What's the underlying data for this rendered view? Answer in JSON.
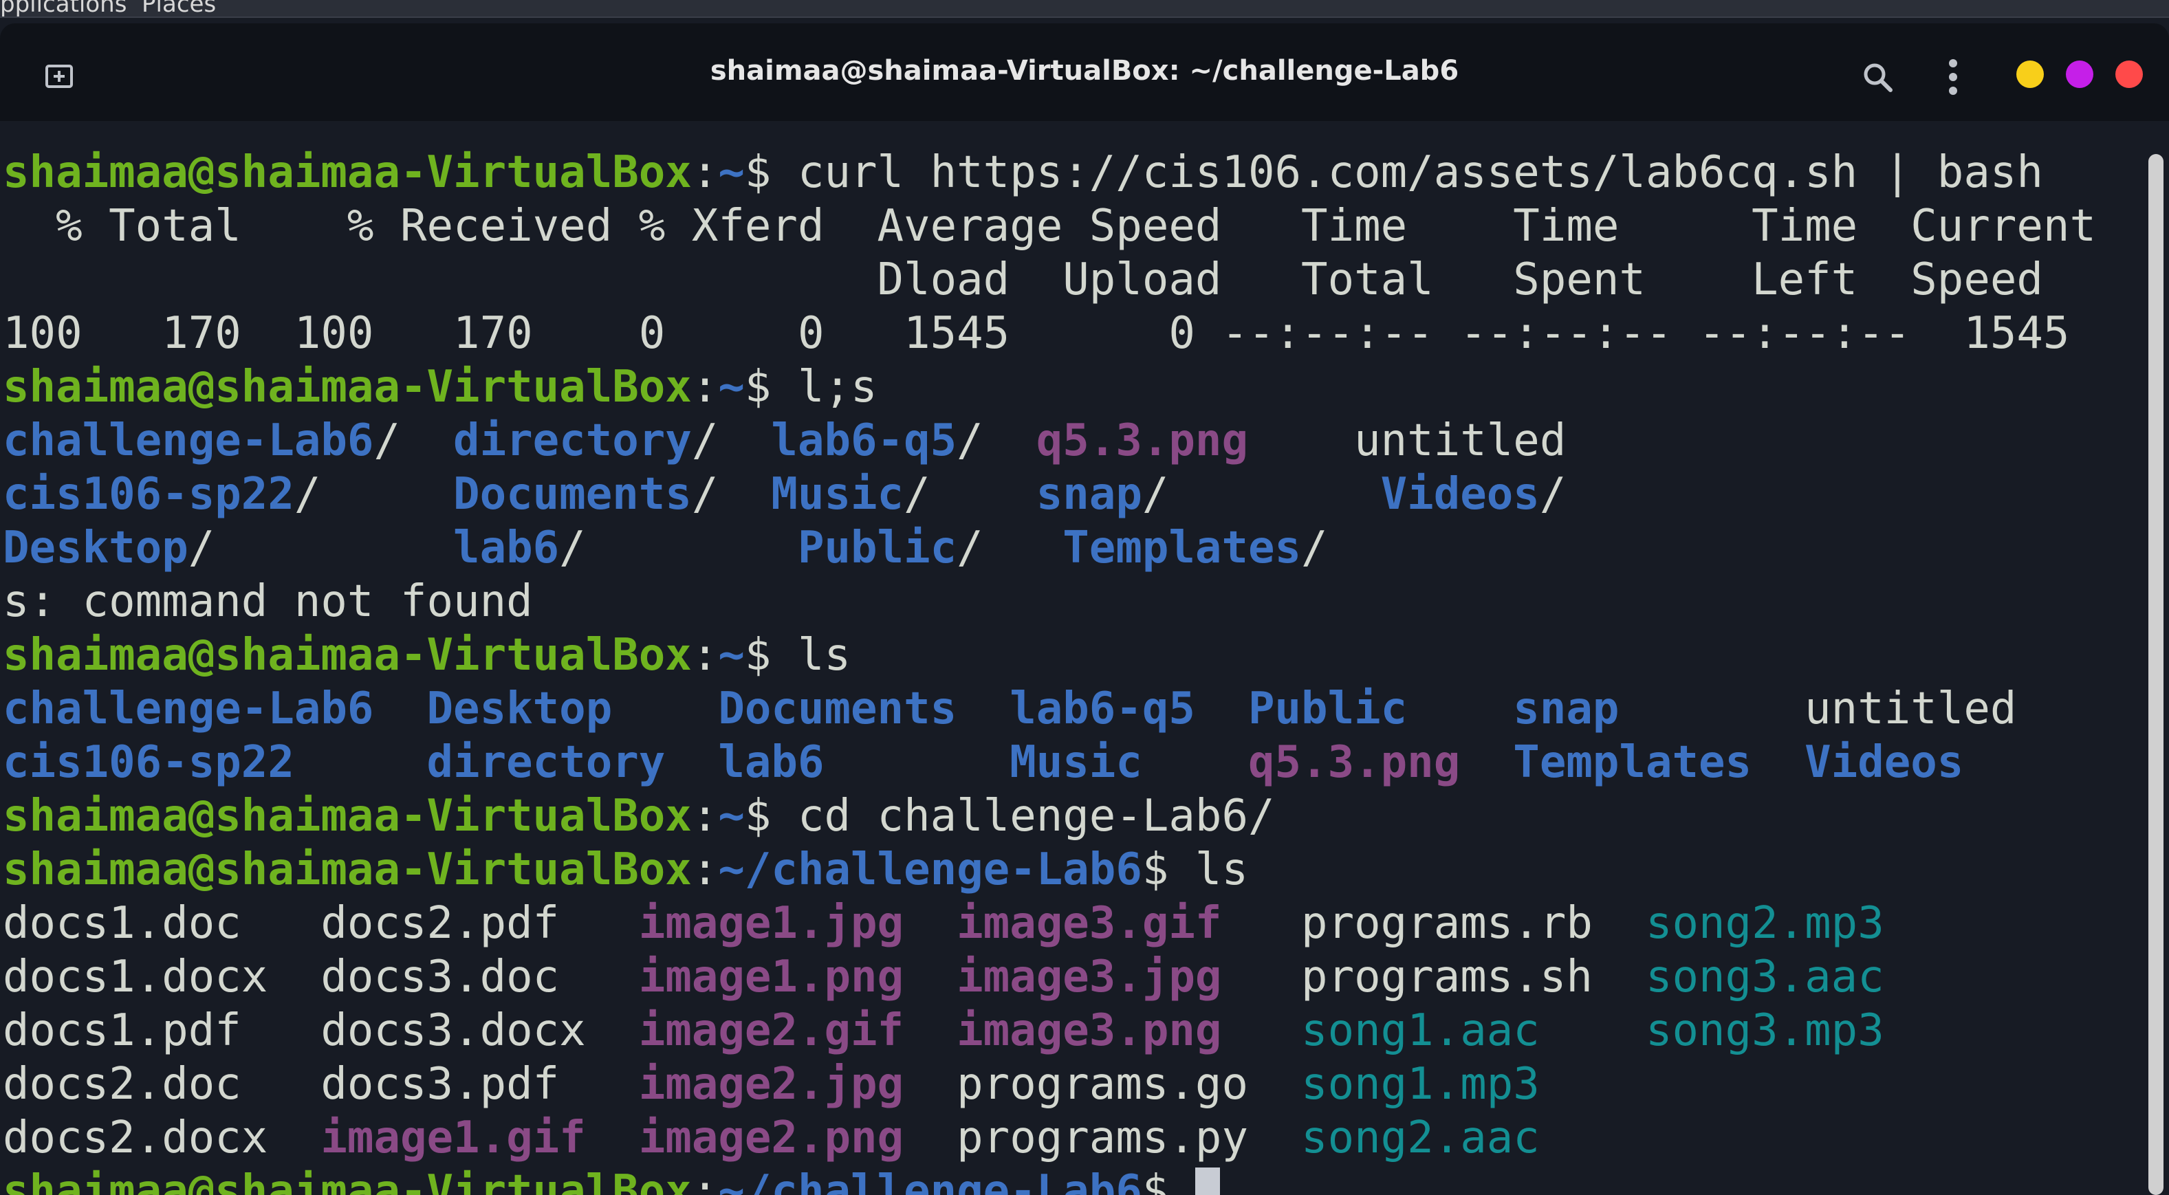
{
  "topbar": {
    "text": "pplications  Places"
  },
  "window": {
    "title": "shaimaa@shaimaa-VirtualBox: ~/challenge-Lab6"
  },
  "icons": {
    "new_tab": "new-tab-icon",
    "search": "search-icon",
    "menu": "kebab-menu-icon"
  },
  "colors": {
    "prompt": "#6fb31f",
    "directory": "#3d72c3",
    "image": "#8a4a86",
    "audio": "#138f93",
    "text": "#d3d7cf",
    "background": "#171b24"
  },
  "terminal": {
    "user_host": "shaimaa@shaimaa-VirtualBox",
    "home": "~",
    "sep": ":",
    "dollar": "$ ",
    "cwd2": "~/challenge-Lab6",
    "cmd1": "curl https://cis106.com/assets/lab6cq.sh | bash",
    "curl_h1": "  % Total    % Received % Xferd  Average Speed   Time    Time     Time  Current",
    "curl_h2": "                                 Dload  Upload   Total   Spent    Left  Speed",
    "curl_h3": "100   170  100   170    0     0   1545      0 --:--:-- --:--:-- --:--:--  1545",
    "cmd2": "l;s",
    "ls1": {
      "r1": [
        "challenge-Lab6",
        "/  ",
        "directory",
        "/  ",
        "lab6-q5",
        "/  ",
        "q5.3.png",
        "    untitled"
      ],
      "r2": [
        "cis106-sp22",
        "/     ",
        "Documents",
        "/  ",
        "Music",
        "/    ",
        "snap",
        "/        ",
        "Videos",
        "/"
      ],
      "r3": [
        "Desktop",
        "/         ",
        "lab6",
        "/        ",
        "Public",
        "/   ",
        "Templates",
        "/"
      ]
    },
    "error": "s: command not found",
    "cmd3": "ls",
    "ls2": {
      "r1": [
        "challenge-Lab6",
        "  ",
        "Desktop",
        "    ",
        "Documents",
        "  ",
        "lab6-q5",
        "  ",
        "Public",
        "    ",
        "snap",
        "       untitled"
      ],
      "r2": [
        "cis106-sp22",
        "     ",
        "directory",
        "  ",
        "lab6",
        "       ",
        "Music",
        "    ",
        "q5.3.png",
        "  ",
        "Templates",
        "  ",
        "Videos"
      ]
    },
    "cmd4": "cd challenge-Lab6/",
    "cmd5": "ls",
    "files": {
      "r1": [
        "docs1.doc   docs2.pdf   ",
        "image1.jpg",
        "  ",
        "image3.gif",
        "   programs.rb  ",
        "song2.mp3"
      ],
      "r2": [
        "docs1.docx  docs3.doc   ",
        "image1.png",
        "  ",
        "image3.jpg",
        "   programs.sh  ",
        "song3.aac"
      ],
      "r3": [
        "docs1.pdf   docs3.docx  ",
        "image2.gif",
        "  ",
        "image3.png",
        "   ",
        "song1.aac",
        "    ",
        "song3.mp3"
      ],
      "r4": [
        "docs2.doc   docs3.pdf   ",
        "image2.jpg",
        "  programs.go  ",
        "song1.mp3"
      ],
      "r5": [
        "docs2.docx  ",
        "image1.gif",
        "  ",
        "image2.png",
        "  programs.py  ",
        "song2.aac"
      ]
    }
  }
}
